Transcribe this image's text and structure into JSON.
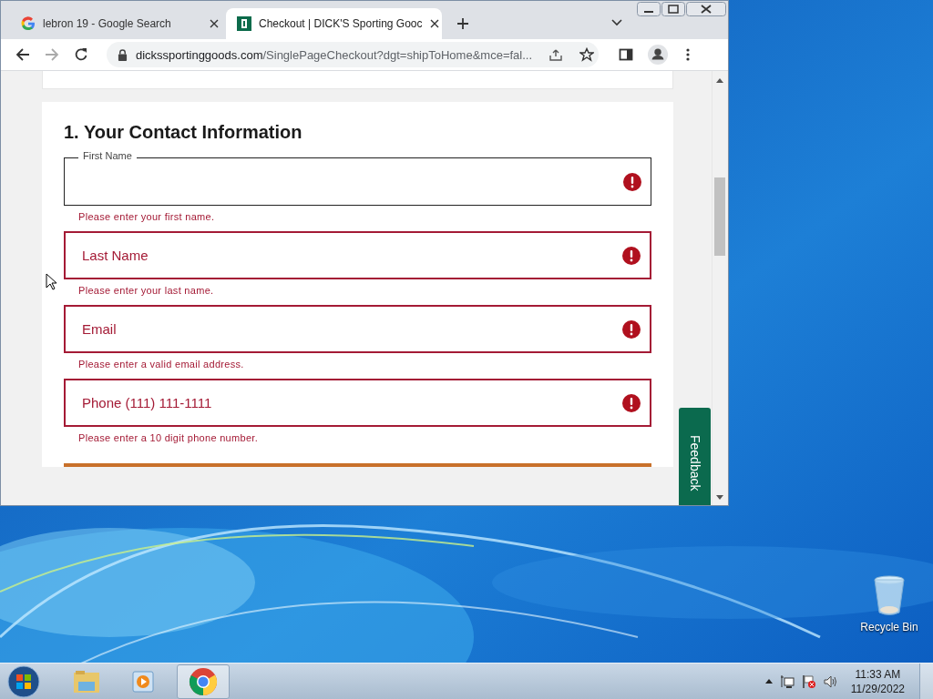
{
  "browser": {
    "tabs": [
      {
        "title": "lebron 19 - Google Search",
        "selected": false
      },
      {
        "title": "Checkout | DICK'S Sporting Gooc",
        "selected": true
      }
    ],
    "address": {
      "domain": "dickssportinggoods.com",
      "path": "/SinglePageCheckout?dgt=shipToHome&mce=fal..."
    }
  },
  "page": {
    "heading": "1. Your Contact Information",
    "fields": [
      {
        "label": "First Name",
        "kind": "floating",
        "error": "Please enter your first name."
      },
      {
        "label": "Last Name",
        "kind": "placeholder",
        "error": "Please enter your last name."
      },
      {
        "label": "Email",
        "kind": "placeholder",
        "error": "Please enter a valid email address."
      },
      {
        "label": "Phone (111) 111-1111",
        "kind": "placeholder",
        "error": "Please enter a 10 digit phone number."
      }
    ],
    "feedback": "Feedback"
  },
  "desktop": {
    "icons": [
      {
        "label": "Recycle Bin"
      }
    ]
  },
  "taskbar": {
    "time": "11:33 AM",
    "date": "11/29/2022"
  }
}
